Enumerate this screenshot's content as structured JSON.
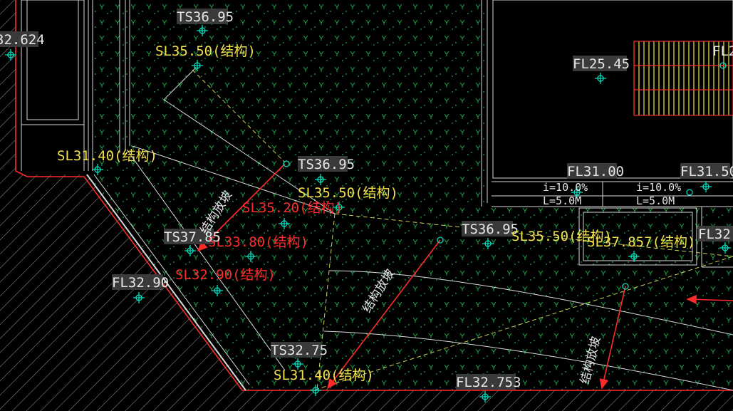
{
  "colors": {
    "background": "#000000",
    "linework": "#d9d9d9",
    "boundary": "#ff2a2a",
    "pattern": "#1fa84a",
    "marker": "#00e0c0",
    "slope_line": "#c8d25a",
    "label_white": "#e6e6e6",
    "label_yellow": "#f2e24a",
    "label_red": "#ff2a2a",
    "stair": "#f2e24a"
  },
  "marker_icon": "crosshair-circle",
  "labels": {
    "ts_top": "TS36.95",
    "sl_top": "SL35.50(结构)",
    "corner_left": "32.624",
    "sl_left": "SL31.40(结构)",
    "fl_room": "FL25.45",
    "fl_room_right": "FL2",
    "ts_mid": "TS36.95",
    "sl_mid": "SL35.50(结构)",
    "sl_red1": "SL35.20(结构)",
    "sl_red2": "SL33.80(结构)",
    "sl_red3": "SL32.90(结构)",
    "ts_left": "TS37.85",
    "fl_left": "FL32.90",
    "fl_a": "FL31.00",
    "fl_b": "FL31.50",
    "slope_a": "i=10.0%",
    "len_a": "L=5.0M",
    "slope_b": "i=10.0%",
    "len_b": "L=5.0M",
    "ts_right": "TS36.95",
    "sl_right": "SL35.50(结构)",
    "sl_right2": "SL37.857(结构)",
    "fl_edge": "FL32.",
    "slope_note1": "结构放坡",
    "slope_note2": "结构放坡",
    "slope_note3": "结构放坡",
    "ts_bottom": "TS32.75",
    "sl_bottom": "SL31.40(结构)",
    "fl_bottom": "FL32.753"
  }
}
